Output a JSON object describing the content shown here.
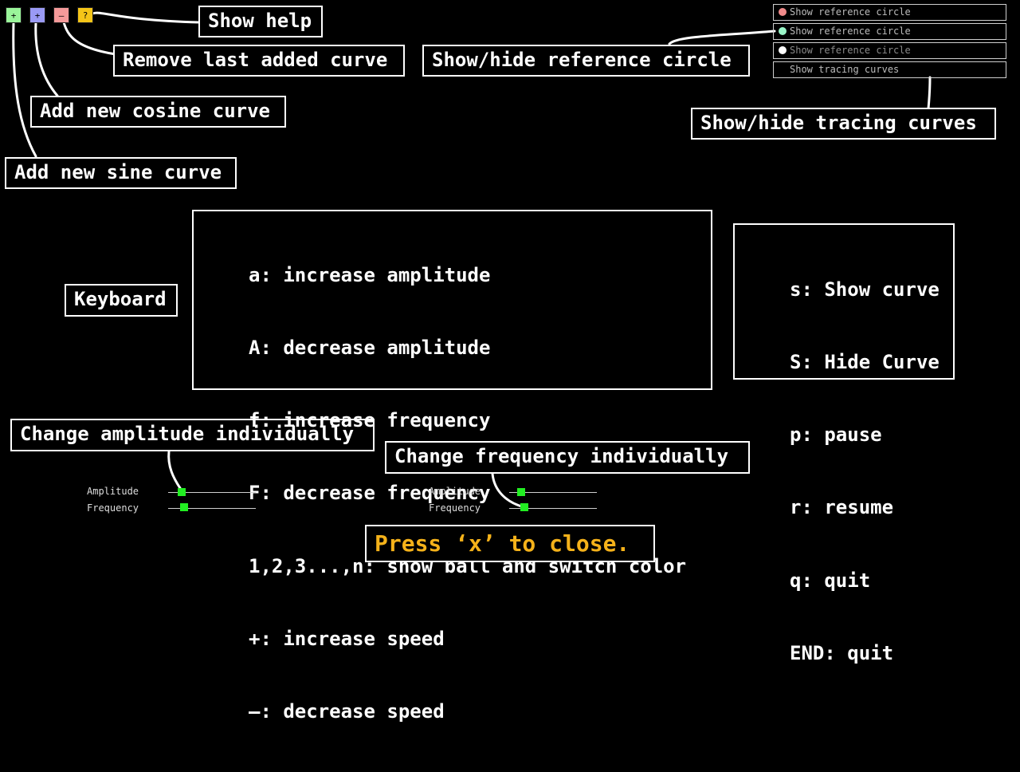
{
  "toolbar": {
    "buttons": [
      {
        "name": "add-sine-button",
        "glyph": "+",
        "color": "#9af59a"
      },
      {
        "name": "add-cosine-button",
        "glyph": "+",
        "color": "#9a9af5"
      },
      {
        "name": "remove-curve-button",
        "glyph": "–",
        "color": "#f59a9a"
      },
      {
        "name": "help-button",
        "glyph": "?",
        "color": "#f5c518"
      }
    ]
  },
  "callouts": {
    "show_help": "Show help",
    "remove_last": "Remove last added curve",
    "add_cosine": "Add new cosine curve",
    "add_sine": "Add new sine curve",
    "show_hide_circle": "Show/hide reference circle",
    "show_hide_tracing": "Show/hide tracing curves",
    "change_amplitude": "Change amplitude individually",
    "change_frequency": "Change frequency individually",
    "keyboard": "Keyboard"
  },
  "legend": {
    "items": [
      {
        "label": "Show reference circle",
        "dot_color": "#f08a8a"
      },
      {
        "label": "Show reference circle",
        "dot_color": "#9af5c8"
      },
      {
        "label": "Show reference circle",
        "dot_color": "#ffffff"
      },
      {
        "label": "Show tracing curves",
        "dot_color": ""
      }
    ]
  },
  "keyboard": {
    "left": [
      "a: increase amplitude",
      "A: decrease amplitude",
      "f: increase frequency",
      "F: decrease frequency",
      "1,2,3...,n: show ball and switch color",
      "+: increase speed",
      "—: decrease speed"
    ],
    "right": [
      "s: Show curve",
      "S: Hide Curve",
      "p: pause",
      "r: resume",
      "q: quit",
      "END: quit"
    ]
  },
  "sliders": {
    "amplitude_label": "Amplitude",
    "frequency_label": "Frequency",
    "panel1": {
      "amplitude": 0.15,
      "frequency": 0.18
    },
    "panel2": {
      "amplitude": 0.14,
      "frequency": 0.17
    }
  },
  "footer": {
    "close_hint": "Press ‘x’ to close.",
    "close_color": "#f5b21a"
  }
}
